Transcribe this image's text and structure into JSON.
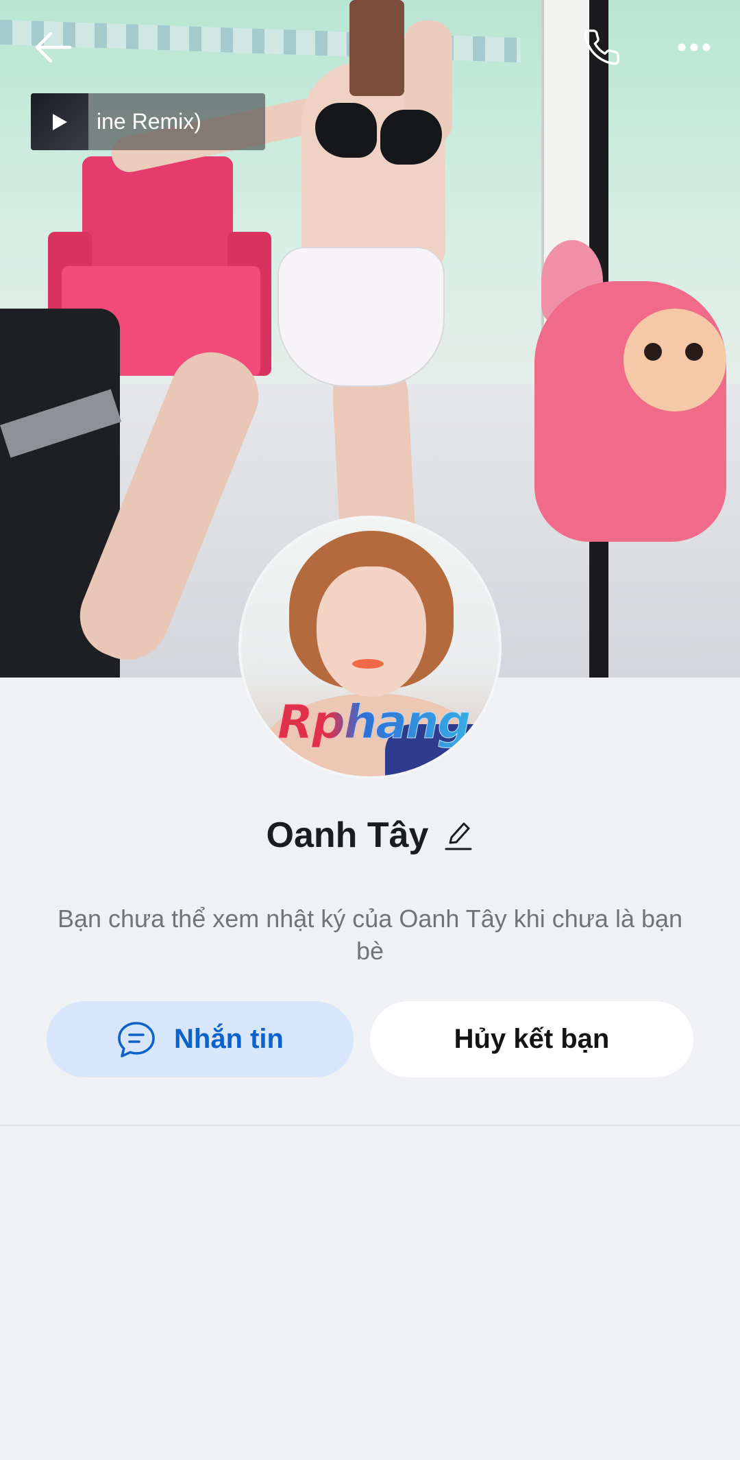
{
  "header": {
    "back_icon": "arrow-left-icon",
    "call_icon": "phone-icon",
    "more_icon": "more-horizontal-icon"
  },
  "music": {
    "title": "ine Remix)",
    "play_icon": "play-icon"
  },
  "profile": {
    "name": "Oanh Tây",
    "edit_icon": "pencil-icon",
    "avatar_watermark": "Rphang",
    "info_text": "Bạn chưa thể xem nhật ký của Oanh Tây khi chưa là bạn bè"
  },
  "actions": {
    "message_label": "Nhắn tin",
    "message_icon": "chat-bubble-icon",
    "unfriend_label": "Hủy kết bạn"
  },
  "colors": {
    "page_bg": "#eff1f5",
    "message_button_bg": "#d7e6fb",
    "message_button_text": "#0c62c9",
    "unfriend_button_bg": "#ffffff"
  }
}
